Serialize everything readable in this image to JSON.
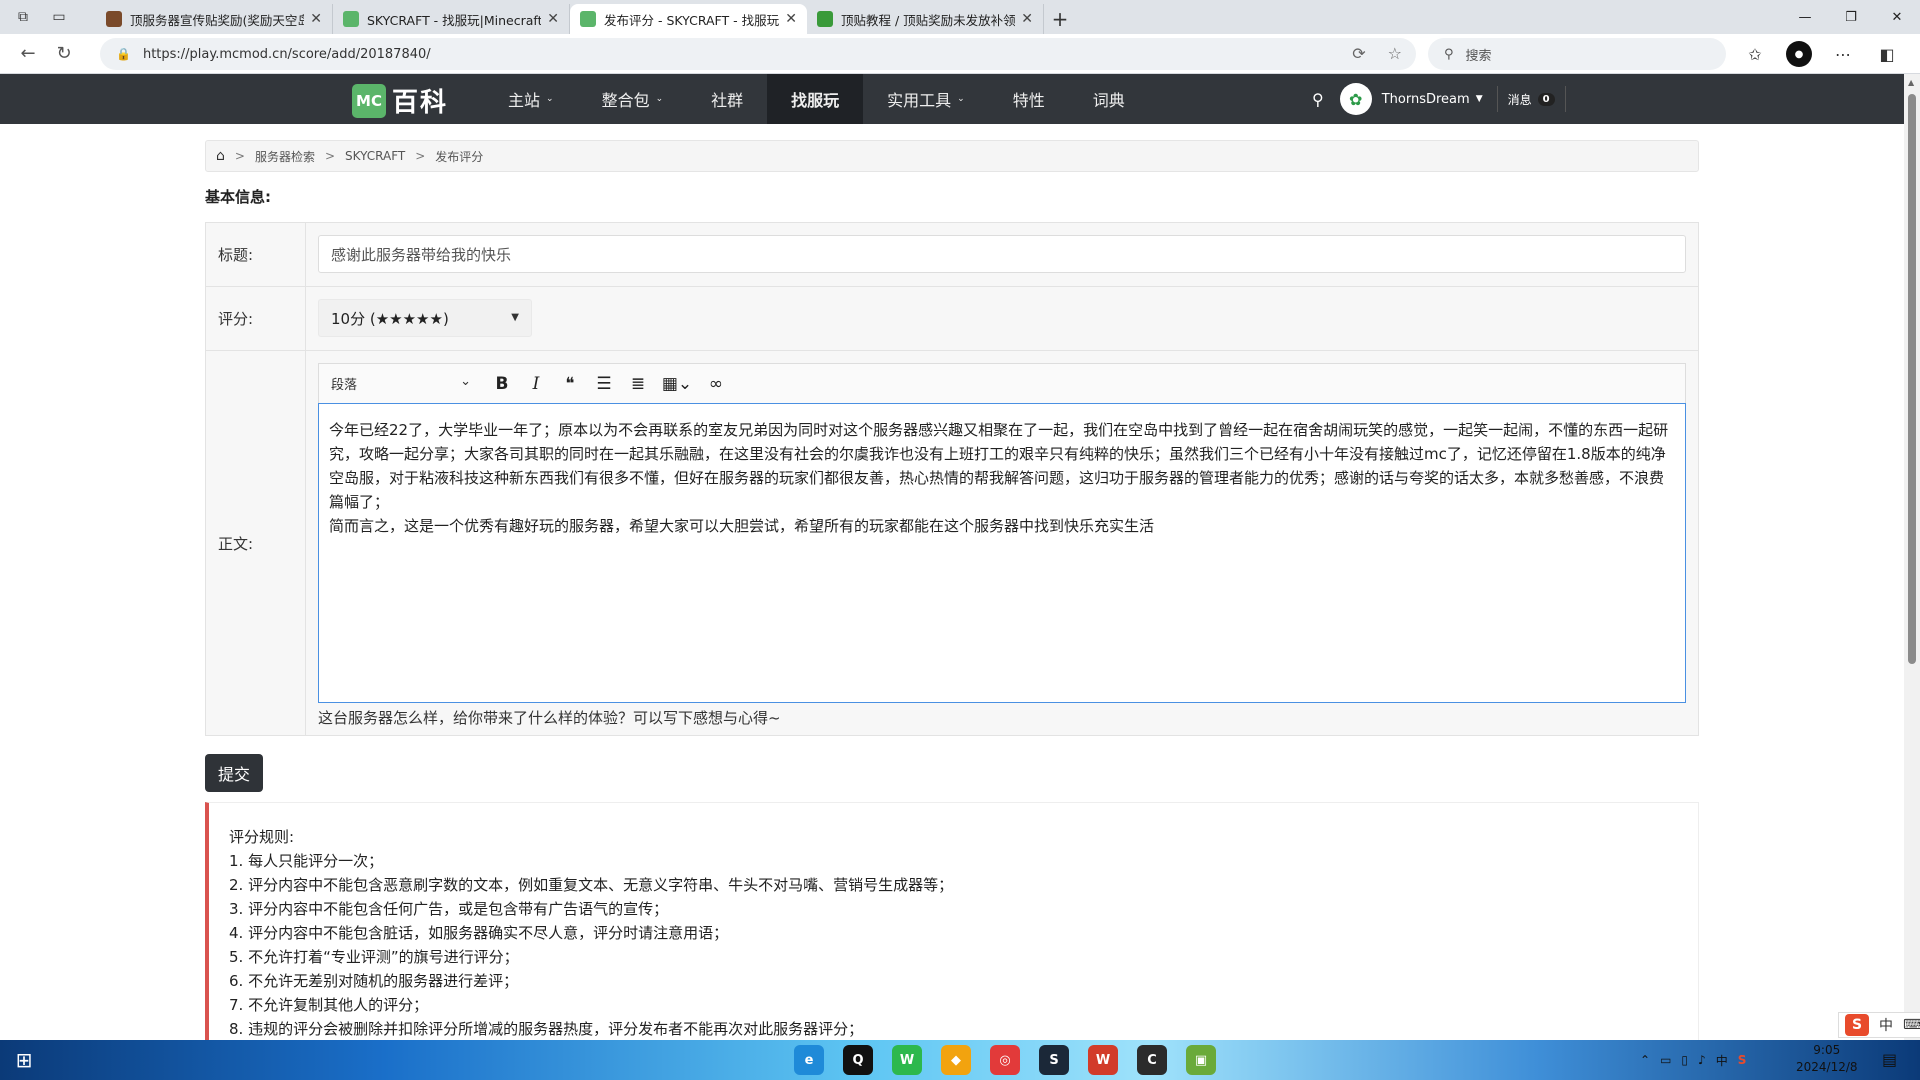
{
  "browser": {
    "tabs": [
      {
        "title": "顶服务器宣传贴奖励(奖励天空岛#",
        "active": false,
        "favicon_color": "#7a4a2a"
      },
      {
        "title": "SKYCRAFT - 找服玩|Minecraft服务",
        "active": false,
        "favicon_color": "#5bb56a"
      },
      {
        "title": "发布评分 - SKYCRAFT - 找服玩|Mi",
        "active": true,
        "favicon_color": "#5bb56a"
      },
      {
        "title": "顶贴教程 / 顶贴奖励未发放补领理",
        "active": false,
        "favicon_color": "#3a9a3a"
      }
    ],
    "url": "https://play.mcmod.cn/score/add/20187840/",
    "search_placeholder": "搜索"
  },
  "site": {
    "logo_mc": "MC",
    "logo_text": "百科",
    "nav": [
      {
        "label": "主站",
        "dropdown": true,
        "active": false
      },
      {
        "label": "整合包",
        "dropdown": true,
        "active": false
      },
      {
        "label": "社群",
        "dropdown": false,
        "active": false
      },
      {
        "label": "找服玩",
        "dropdown": false,
        "active": true
      },
      {
        "label": "实用工具",
        "dropdown": true,
        "active": false
      },
      {
        "label": "特性",
        "dropdown": false,
        "active": false
      },
      {
        "label": "词典",
        "dropdown": false,
        "active": false
      }
    ],
    "username": "ThornsDream",
    "messages_label": "消息",
    "messages_count": "0"
  },
  "breadcrumb": [
    "服务器检索",
    "SKYCRAFT",
    "发布评分"
  ],
  "form": {
    "section_title": "基本信息:",
    "title_label": "标题:",
    "title_value": "感谢此服务器带给我的快乐",
    "score_label": "评分:",
    "score_value": "10分 (★★★★★)",
    "body_label": "正文:",
    "toolbar_paragraph": "段落",
    "body_lines": [
      "今年已经22了，大学毕业一年了；原本以为不会再联系的室友兄弟因为同时对这个服务器感兴趣又相聚在了一起，我们在空岛中找到了曾经一起在宿舍胡闹玩笑的感觉，一起笑一起闹，不懂的东西一起研究，攻略一起分享；大家各司其职的同时在一起其乐融融，在这里没有社会的尔虞我诈也没有上班打工的艰辛只有纯粹的快乐；虽然我们三个已经有小十年没有接触过mc了，记忆还停留在1.8版本的纯净空岛服，对于粘液科技这种新东西我们有很多不懂，但好在服务器的玩家们都很友善，热心热情的帮我解答问题，这归功于服务器的管理者能力的优秀；感谢的话与夸奖的话太多，本就多愁善感，不浪费篇幅了；",
      "简而言之，这是一个优秀有趣好玩的服务器，希望大家可以大胆尝试，希望所有的玩家都能在这个服务器中找到快乐充实生活"
    ],
    "hint": "这台服务器怎么样，给你带来了什么样的体验？可以写下感想与心得~",
    "submit_label": "提交"
  },
  "rules": {
    "title": "评分规则:",
    "items": [
      "1. 每人只能评分一次；",
      "2. 评分内容中不能包含恶意刷字数的文本，例如重复文本、无意义字符串、牛头不对马嘴、营销号生成器等；",
      "3. 评分内容中不能包含任何广告，或是包含带有广告语气的宣传；",
      "4. 评分内容中不能包含脏话，如服务器确实不尽人意，评分时请注意用语；",
      "5. 不允许打着“专业评测”的旗号进行评分；",
      "6. 不允许无差别对随机的服务器进行差评；",
      "7. 不允许复制其他人的评分；",
      "8. 违规的评分会被删除并扣除评分所增减的服务器热度，评分发布者不能再次对此服务器评分；"
    ]
  },
  "taskbar": {
    "time": "9:05",
    "date": "2024/12/8",
    "ime_lang": "中"
  }
}
